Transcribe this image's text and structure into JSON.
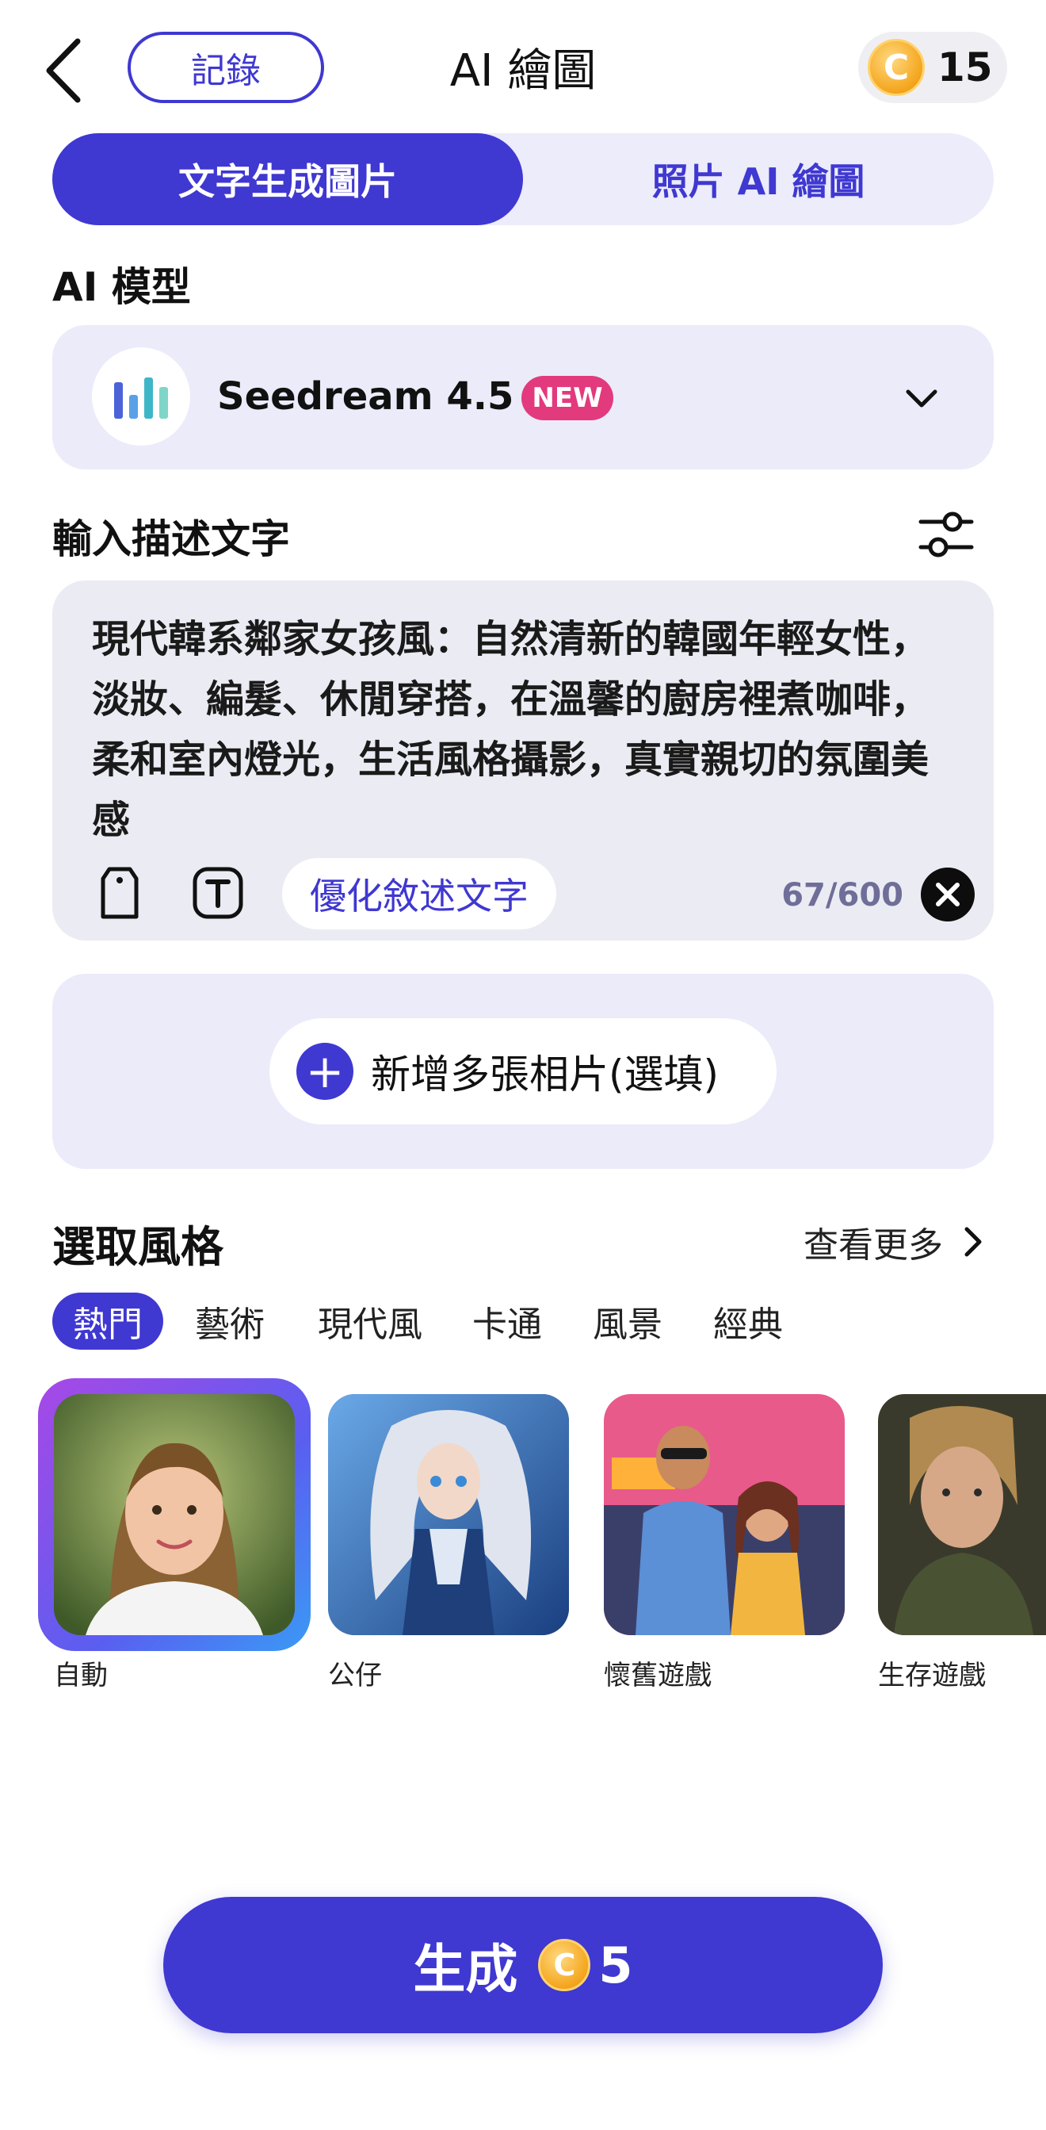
{
  "header": {
    "back_icon": "chevron-left-icon",
    "records_label": "記錄",
    "title": "AI 繪圖",
    "coin_icon": "coin-icon",
    "coin_symbol": "C",
    "coin_balance": "15"
  },
  "tabs": [
    {
      "label": "文字生成圖片",
      "active": true
    },
    {
      "label": "照片 AI 繪圖",
      "active": false
    }
  ],
  "model": {
    "section_label": "AI 模型",
    "name": "Seedream 4.5",
    "badge": "NEW",
    "logo_colors": [
      "#4b63d6",
      "#5aa0e6",
      "#3fb6c8",
      "#7fd6c8"
    ],
    "dropdown_icon": "chevron-down-icon"
  },
  "prompt": {
    "section_label": "輸入描述文字",
    "settings_icon": "sliders-icon",
    "text": "現代韓系鄰家女孩風：自然清新的韓國年輕女性，淡妝、編髮、休閒穿搭，在溫馨的廚房裡煮咖啡，柔和室內燈光，生活風格攝影，真實親切的氛圍美感",
    "tag_icon": "tag-icon",
    "text_icon": "text-format-icon",
    "optimize_label": "優化敘述文字",
    "counter": "67/600",
    "clear_icon": "close-circle-icon"
  },
  "add_photos": {
    "icon": "plus-icon",
    "label": "新增多張相片(選填)"
  },
  "style": {
    "section_label": "選取風格",
    "see_more": "查看更多",
    "see_more_icon": "chevron-right-icon",
    "categories": [
      {
        "label": "熱門",
        "active": true
      },
      {
        "label": "藝術",
        "active": false
      },
      {
        "label": "現代風",
        "active": false
      },
      {
        "label": "卡通",
        "active": false
      },
      {
        "label": "風景",
        "active": false
      },
      {
        "label": "經典",
        "active": false
      }
    ],
    "items": [
      {
        "label": "自動",
        "selected": true
      },
      {
        "label": "公仔",
        "selected": false
      },
      {
        "label": "懷舊遊戲",
        "selected": false
      },
      {
        "label": "生存遊戲",
        "selected": false
      }
    ]
  },
  "generate": {
    "label": "生成",
    "coin_symbol": "C",
    "cost": "5"
  },
  "colors": {
    "accent": "#3f38d1",
    "badge": "#e23a7c",
    "card_bg": "#ebebfa"
  }
}
